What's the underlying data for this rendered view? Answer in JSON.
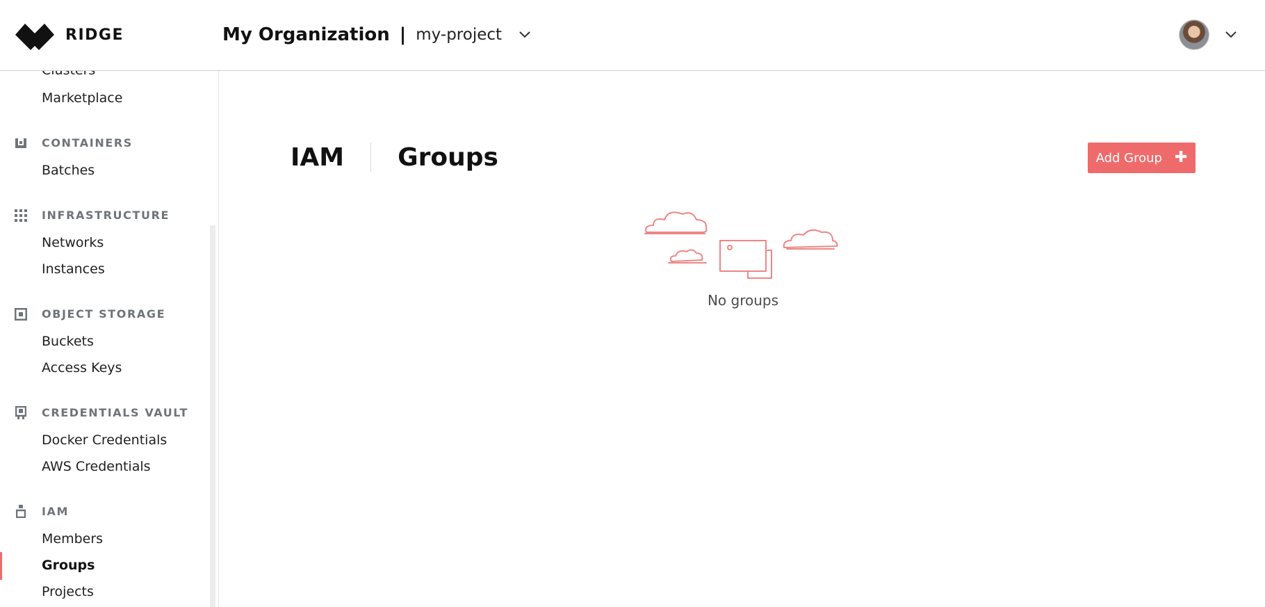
{
  "brand": {
    "name": "RIDGE",
    "accent_color": "#ef6b6b"
  },
  "header": {
    "organization": "My Organization",
    "separator": "|",
    "project": "my-project"
  },
  "sidebar": {
    "items": {
      "clusters": "Clusters",
      "marketplace": "Marketplace",
      "batches": "Batches",
      "networks": "Networks",
      "instances": "Instances",
      "buckets": "Buckets",
      "access_keys": "Access Keys",
      "docker_credentials": "Docker Credentials",
      "aws_credentials": "AWS Credentials",
      "members": "Members",
      "groups": "Groups",
      "projects": "Projects"
    },
    "sections": {
      "containers": "CONTAINERS",
      "infrastructure": "INFRASTRUCTURE",
      "object_storage": "OBJECT STORAGE",
      "credentials_vault": "CREDENTIALS VAULT",
      "iam": "IAM"
    },
    "active_item": "Groups"
  },
  "main": {
    "title_section": "IAM",
    "title_page": "Groups",
    "add_button_label": "Add Group",
    "empty_state_text": "No groups"
  }
}
